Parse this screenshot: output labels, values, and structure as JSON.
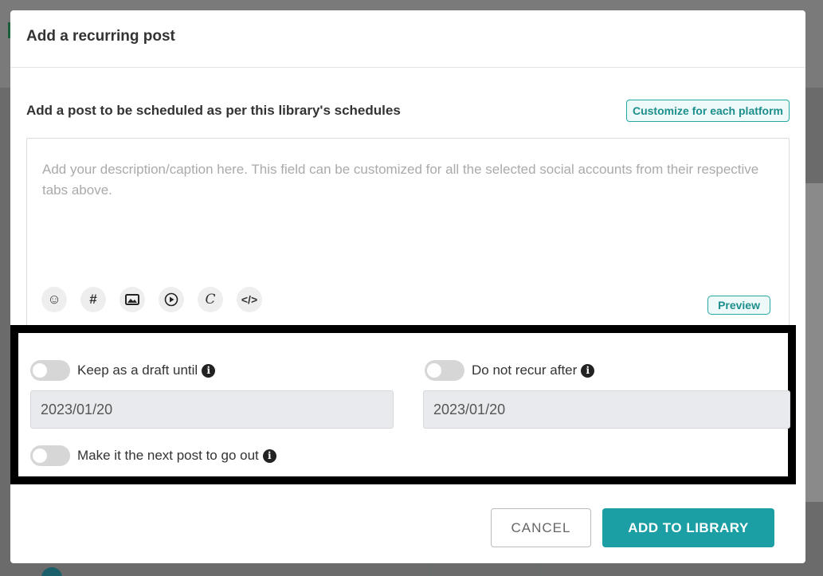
{
  "modal": {
    "title": "Add a recurring post",
    "section_title": "Add a post to be scheduled as per this library's schedules",
    "customize_label": "Customize for each platform",
    "editor_placeholder": "Add your description/caption here. This field can be customized for all the selected social accounts from their respective tabs above.",
    "toolbar": [
      {
        "icon": "emoji-icon",
        "glyph": "☺"
      },
      {
        "icon": "hashtag-icon",
        "glyph": "#"
      },
      {
        "icon": "image-icon",
        "glyph": "▬"
      },
      {
        "icon": "video-icon",
        "glyph": "▶"
      },
      {
        "icon": "canva-icon",
        "glyph": "C"
      },
      {
        "icon": "code-icon",
        "glyph": "</>"
      }
    ],
    "preview_label": "Preview",
    "options": {
      "draft_label": "Keep as a draft until",
      "draft_date": "2023/01/20",
      "recur_label": "Do not recur after",
      "recur_date": "2023/01/20",
      "next_post_label": "Make it the next post to go out"
    },
    "cancel_label": "CANCEL",
    "add_label": "ADD TO LIBRARY"
  },
  "colors": {
    "accent": "#1b9ea4",
    "accent_text": "#1c8f8c"
  }
}
